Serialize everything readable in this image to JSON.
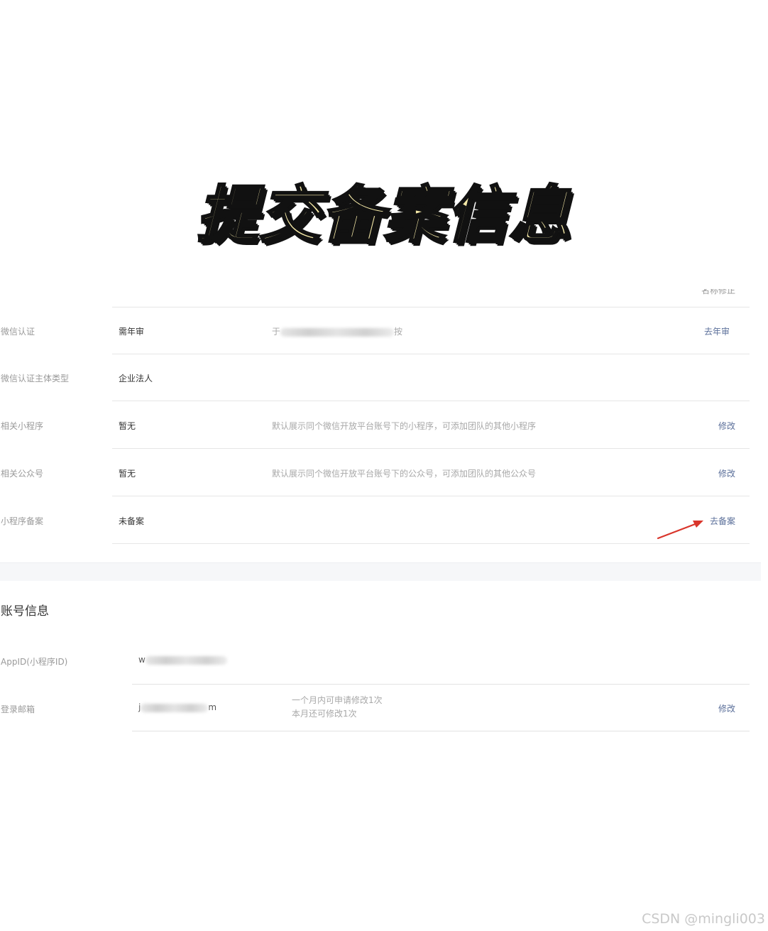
{
  "overlay_title": "提交备案信息",
  "partial_top_action": "名称修正",
  "rows": [
    {
      "label": "微信认证",
      "value": "需年审",
      "desc_prefix": "于",
      "desc_suffix": "按",
      "action": "去年审"
    },
    {
      "label": "微信认证主体类型",
      "value": "企业法人",
      "desc": "",
      "action": ""
    },
    {
      "label": "相关小程序",
      "value": "暂无",
      "desc": "默认展示同个微信开放平台账号下的小程序，可添加团队的其他小程序",
      "action": "修改"
    },
    {
      "label": "相关公众号",
      "value": "暂无",
      "desc": "默认展示同个微信开放平台账号下的公众号，可添加团队的其他公众号",
      "action": "修改"
    },
    {
      "label": "小程序备案",
      "value": "未备案",
      "desc": "",
      "action": "去备案"
    }
  ],
  "account": {
    "title": "账号信息",
    "appid": {
      "label": "AppID(小程序ID)",
      "value_prefix": "w"
    },
    "email": {
      "label": "登录邮箱",
      "value_prefix": "j",
      "value_suffix": "m",
      "note_line1": "一个月内可申请修改1次",
      "note_line2": "本月还可修改1次",
      "action": "修改"
    }
  },
  "watermark": "CSDN @mingli003",
  "colors": {
    "link": "#5b6f9a",
    "arrow": "#d9352b",
    "title_fill": "#f6eaa8"
  }
}
